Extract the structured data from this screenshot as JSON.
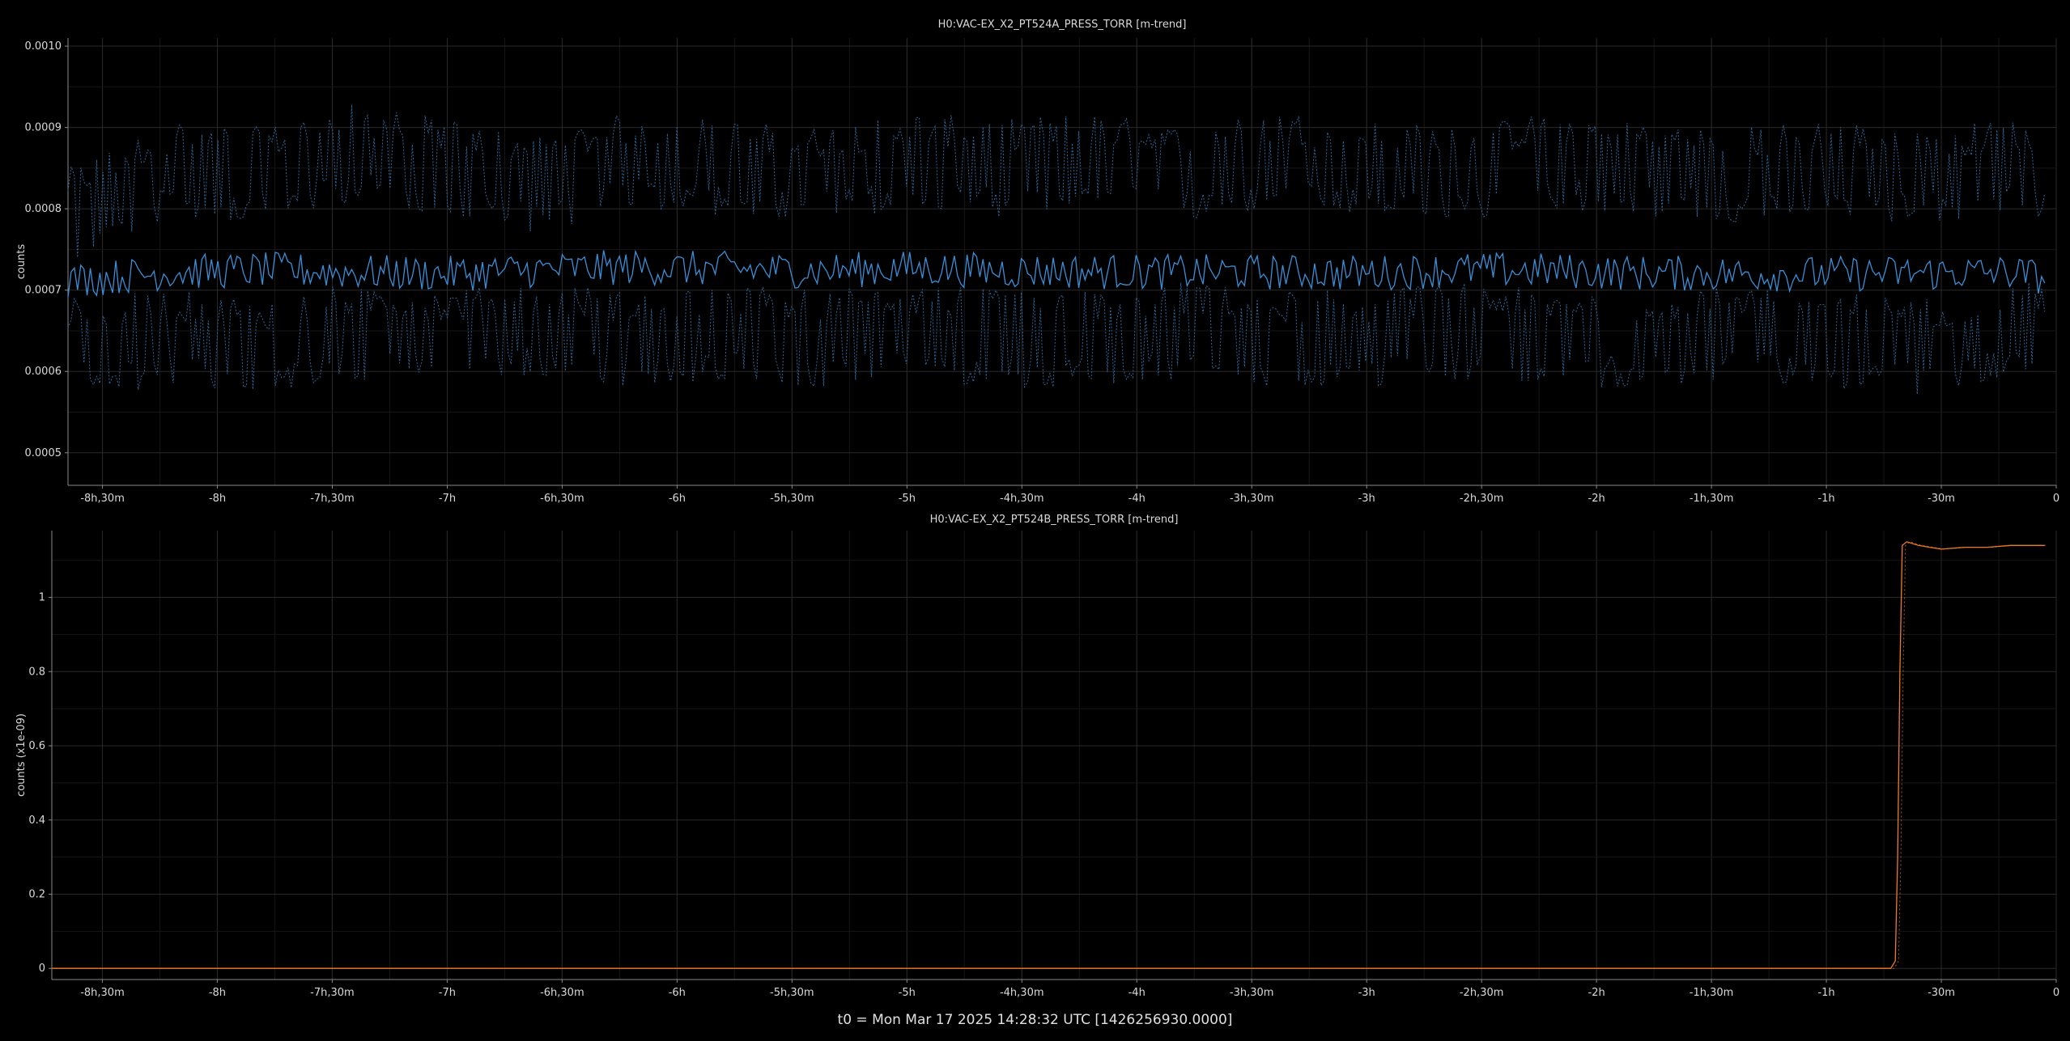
{
  "footer": {
    "t0_label": "t0 = Mon Mar 17 2025 14:28:32 UTC [1426256930.0000]"
  },
  "colors": {
    "background": "#000000",
    "grid_major": "#2a2a2a",
    "grid_minor": "#161616",
    "axis": "#8a8a8a",
    "series_a": "#3a8fd8",
    "series_a_bounds": "#2d6a9c",
    "series_b": "#f07a24"
  },
  "chart_data": [
    {
      "type": "line",
      "title": "H0:VAC-EX_X2_PT524A_PRESS_TORR [m-trend]",
      "xlabel": "",
      "ylabel": "counts",
      "x_unit": "hours relative to t0",
      "xlim": [
        -8.65,
        0
      ],
      "ylim": [
        0.00046,
        0.00101
      ],
      "x_ticks": [
        {
          "value": -8.5,
          "label": "-8h,30m"
        },
        {
          "value": -8,
          "label": "-8h"
        },
        {
          "value": -7.5,
          "label": "-7h,30m"
        },
        {
          "value": -7,
          "label": "-7h"
        },
        {
          "value": -6.5,
          "label": "-6h,30m"
        },
        {
          "value": -6,
          "label": "-6h"
        },
        {
          "value": -5.5,
          "label": "-5h,30m"
        },
        {
          "value": -5,
          "label": "-5h"
        },
        {
          "value": -4.5,
          "label": "-4h,30m"
        },
        {
          "value": -4,
          "label": "-4h"
        },
        {
          "value": -3.5,
          "label": "-3h,30m"
        },
        {
          "value": -3,
          "label": "-3h"
        },
        {
          "value": -2.5,
          "label": "-2h,30m"
        },
        {
          "value": -2,
          "label": "-2h"
        },
        {
          "value": -1.5,
          "label": "-1h,30m"
        },
        {
          "value": -1,
          "label": "-1h"
        },
        {
          "value": -0.5,
          "label": "-30m"
        },
        {
          "value": 0,
          "label": "0"
        }
      ],
      "y_ticks": [
        {
          "value": 0.0005,
          "label": "0.0005"
        },
        {
          "value": 0.0006,
          "label": "0.0006"
        },
        {
          "value": 0.0007,
          "label": "0.0007"
        },
        {
          "value": 0.0008,
          "label": "0.0008"
        },
        {
          "value": 0.0009,
          "label": "0.0009"
        },
        {
          "value": 0.001,
          "label": "0.0010"
        }
      ],
      "grid": true,
      "series": [
        {
          "role": "max",
          "style": "dotted",
          "x": [
            -8.65,
            -8.2,
            -7.8,
            -7.4,
            -7.0,
            -6.6,
            -6.2,
            -5.8,
            -5.4,
            -5.0,
            -4.6,
            -4.2,
            -3.8,
            -3.4,
            -3.0,
            -2.6,
            -2.2,
            -1.8,
            -1.4,
            -1.0,
            -0.6,
            -0.2,
            -0.05
          ],
          "values": [
            0.00079,
            0.00085,
            0.00084,
            0.00087,
            0.00085,
            0.00083,
            0.00086,
            0.00085,
            0.00084,
            0.00086,
            0.00085,
            0.00086,
            0.00084,
            0.00086,
            0.00085,
            0.00084,
            0.00086,
            0.00085,
            0.00084,
            0.00085,
            0.00084,
            0.00085,
            0.00084
          ]
        },
        {
          "role": "mean",
          "style": "solid",
          "x": [
            -8.65,
            -8.2,
            -7.8,
            -7.4,
            -7.0,
            -6.6,
            -6.2,
            -5.8,
            -5.4,
            -5.0,
            -4.6,
            -4.2,
            -3.8,
            -3.4,
            -3.0,
            -2.6,
            -2.2,
            -1.8,
            -1.4,
            -1.0,
            -0.6,
            -0.2,
            -0.05
          ],
          "values": [
            0.000712,
            0.000722,
            0.000725,
            0.000722,
            0.00072,
            0.000725,
            0.000728,
            0.000726,
            0.000724,
            0.000727,
            0.000724,
            0.000723,
            0.000722,
            0.000722,
            0.000721,
            0.000725,
            0.000724,
            0.000721,
            0.00072,
            0.00072,
            0.000721,
            0.000722,
            0.000716
          ]
        },
        {
          "role": "min",
          "style": "dotted",
          "x": [
            -8.65,
            -8.2,
            -7.8,
            -7.4,
            -7.0,
            -6.6,
            -6.2,
            -5.8,
            -5.4,
            -5.0,
            -4.6,
            -4.2,
            -3.8,
            -3.4,
            -3.0,
            -2.6,
            -2.2,
            -1.8,
            -1.4,
            -1.0,
            -0.6,
            -0.2,
            -0.05
          ],
          "values": [
            0.00063,
            0.00064,
            0.00063,
            0.00065,
            0.00064,
            0.00065,
            0.00064,
            0.00065,
            0.00064,
            0.00065,
            0.00064,
            0.00064,
            0.00065,
            0.00064,
            0.00064,
            0.00065,
            0.00064,
            0.00064,
            0.00065,
            0.00064,
            0.00063,
            0.00065,
            0.00065
          ]
        }
      ]
    },
    {
      "type": "line",
      "title": "H0:VAC-EX_X2_PT524B_PRESS_TORR [m-trend]",
      "xlabel": "",
      "ylabel": "counts (x1e-09)",
      "x_unit": "hours relative to t0",
      "xlim": [
        -8.72,
        0
      ],
      "ylim": [
        -0.03,
        1.18
      ],
      "x_ticks": [
        {
          "value": -8.5,
          "label": "-8h,30m"
        },
        {
          "value": -8,
          "label": "-8h"
        },
        {
          "value": -7.5,
          "label": "-7h,30m"
        },
        {
          "value": -7,
          "label": "-7h"
        },
        {
          "value": -6.5,
          "label": "-6h,30m"
        },
        {
          "value": -6,
          "label": "-6h"
        },
        {
          "value": -5.5,
          "label": "-5h,30m"
        },
        {
          "value": -5,
          "label": "-5h"
        },
        {
          "value": -4.5,
          "label": "-4h,30m"
        },
        {
          "value": -4,
          "label": "-4h"
        },
        {
          "value": -3.5,
          "label": "-3h,30m"
        },
        {
          "value": -3,
          "label": "-3h"
        },
        {
          "value": -2.5,
          "label": "-2h,30m"
        },
        {
          "value": -2,
          "label": "-2h"
        },
        {
          "value": -1.5,
          "label": "-1h,30m"
        },
        {
          "value": -1,
          "label": "-1h"
        },
        {
          "value": -0.5,
          "label": "-30m"
        },
        {
          "value": 0,
          "label": "0"
        }
      ],
      "y_ticks": [
        {
          "value": 0,
          "label": "0"
        },
        {
          "value": 0.2,
          "label": "0.2"
        },
        {
          "value": 0.4,
          "label": "0.4"
        },
        {
          "value": 0.6,
          "label": "0.6"
        },
        {
          "value": 0.8,
          "label": "0.8"
        },
        {
          "value": 1,
          "label": "1"
        }
      ],
      "grid": true,
      "series": [
        {
          "role": "mean",
          "style": "solid",
          "x": [
            -8.72,
            -0.72,
            -0.7,
            -0.69,
            -0.68,
            -0.67,
            -0.65,
            -0.6,
            -0.55,
            -0.5,
            -0.4,
            -0.3,
            -0.2,
            -0.1,
            -0.05
          ],
          "values": [
            0,
            0,
            0.02,
            0.3,
            0.8,
            1.14,
            1.15,
            1.14,
            1.135,
            1.13,
            1.135,
            1.135,
            1.14,
            1.14,
            1.14
          ]
        }
      ]
    }
  ]
}
